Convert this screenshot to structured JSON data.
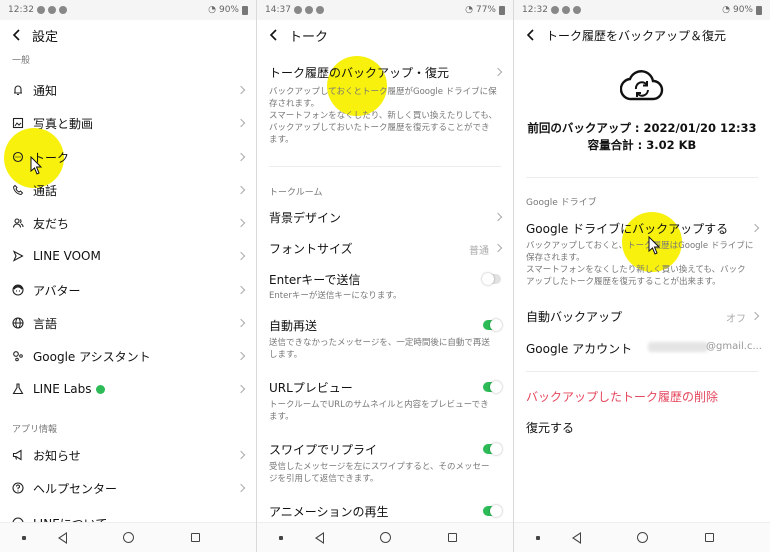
{
  "p1": {
    "status_time": "12:32",
    "status_battery": "90%",
    "title": "設定",
    "section_general": "一般",
    "items": [
      {
        "label": "通知",
        "icon": "bell-icon"
      },
      {
        "label": "写真と動画",
        "icon": "image-icon"
      },
      {
        "label": "トーク",
        "icon": "chat-icon"
      },
      {
        "label": "通話",
        "icon": "phone-icon"
      },
      {
        "label": "友だち",
        "icon": "friends-icon"
      },
      {
        "label": "LINE VOOM",
        "icon": "play-icon"
      },
      {
        "label": "アバター",
        "icon": "avatar-icon"
      },
      {
        "label": "言語",
        "icon": "globe-icon"
      },
      {
        "label": "Google アシスタント",
        "icon": "assistant-icon"
      },
      {
        "label": "LINE Labs",
        "icon": "flask-icon"
      }
    ],
    "section_app": "アプリ情報",
    "app_items": [
      {
        "label": "お知らせ",
        "icon": "megaphone-icon"
      },
      {
        "label": "ヘルプセンター",
        "icon": "help-icon"
      },
      {
        "label": "LINEについて",
        "icon": "line-icon"
      }
    ]
  },
  "p2": {
    "status_time": "14:37",
    "status_battery": "77%",
    "title": "トーク",
    "backup_title": "トーク履歴のバックアップ・復元",
    "backup_desc": "バックアップしておくとトーク履歴がGoogle ドライブに保存されます。\nスマートフォンをなくしたり、新しく買い換えたりしても、バックアップしておいたトーク履歴を復元することができます。",
    "section_talkroom": "トークルーム",
    "bg_design": "背景デザイン",
    "font_size": "フォントサイズ",
    "font_size_value": "普通",
    "enter_send": "Enterキーで送信",
    "enter_send_desc": "Enterキーが送信キーになります。",
    "auto_resend": "自動再送",
    "auto_resend_desc": "送信できなかったメッセージを、一定時間後に自動で再送します。",
    "url_preview": "URLプレビュー",
    "url_preview_desc": "トークルームでURLのサムネイルと内容をプレビューできます。",
    "swipe_reply": "スワイプでリプライ",
    "swipe_reply_desc": "受信したメッセージを左にスワイプすると、そのメッセージを引用して返信できます。",
    "animation": "アニメーションの再生"
  },
  "p3": {
    "status_time": "12:32",
    "status_battery": "90%",
    "title": "トーク履歴をバックアップ＆復元",
    "last_backup": "前回のバックアップ : 2022/01/20 12:33",
    "total_size": "容量合計 : 3.02 KB",
    "section_gdrive": "Google ドライブ",
    "backup_to_drive": "Google ドライブにバックアップする",
    "backup_to_drive_desc": "バックアップしておくと、トーク履歴はGoogle ドライブに保存されます。\nスマートフォンをなくしたり新しく買い換えても、バックアップしたトーク履歴を復元することが出来ます。",
    "auto_backup": "自動バックアップ",
    "auto_backup_value": "オフ",
    "google_account": "Google アカウント",
    "google_account_value": "@gmail.c...",
    "delete_backup": "バックアップしたトーク履歴の削除",
    "restore": "復元する"
  },
  "colors": {
    "accent_green": "#2dbb57",
    "highlight": "#f7f000",
    "danger": "#e5475e"
  }
}
